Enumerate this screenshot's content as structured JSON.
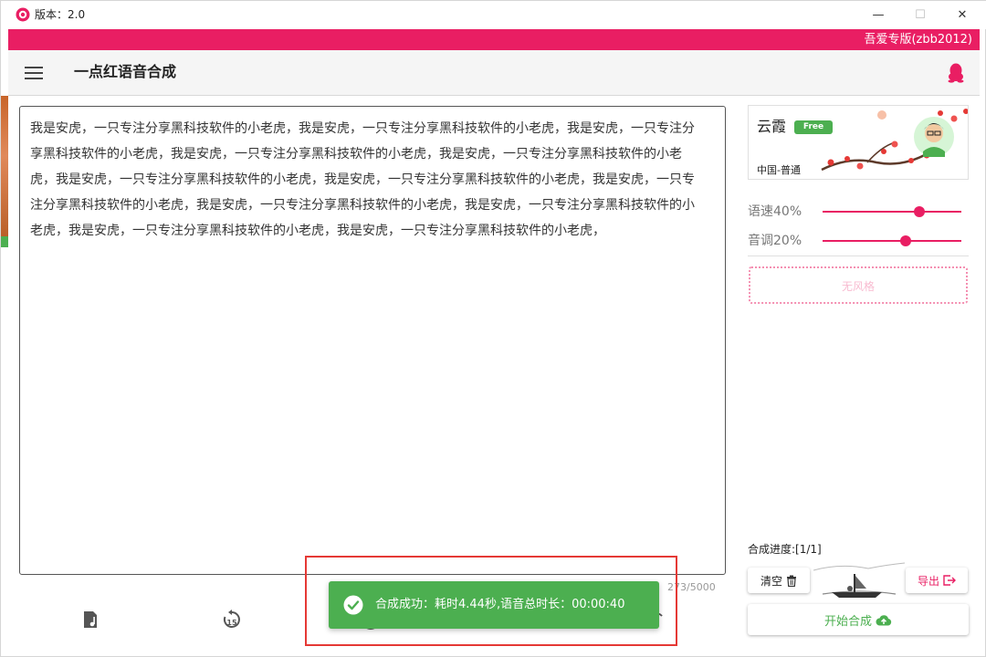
{
  "window": {
    "title": "版本：2.0",
    "controls": {
      "minimize": "—",
      "maximize": "☐",
      "close": "✕"
    }
  },
  "banner": {
    "text": "吾爱专版(zbb2012)"
  },
  "appbar": {
    "title": "一点红语音合成"
  },
  "editor": {
    "text": "我是安虎，一只专注分享黑科技软件的小老虎，我是安虎，一只专注分享黑科技软件的小老虎，我是安虎，一只专注分享黑科技软件的小老虎，我是安虎，一只专注分享黑科技软件的小老虎，我是安虎，一只专注分享黑科技软件的小老虎，我是安虎，一只专注分享黑科技软件的小老虎，我是安虎，一只专注分享黑科技软件的小老虎，我是安虎，一只专注分享黑科技软件的小老虎，我是安虎，一只专注分享黑科技软件的小老虎，我是安虎，一只专注分享黑科技软件的小老虎，我是安虎，一只专注分享黑科技软件的小老虎，我是安虎，一只专注分享黑科技软件的小老虎，",
    "char_count": "273/5000"
  },
  "toast": {
    "text": "合成成功：耗时4.44秒,语音总时长：00:00:40"
  },
  "voice": {
    "name": "云霞",
    "badge": "Free",
    "region": "中国-普通"
  },
  "sliders": [
    {
      "label": "语速40%",
      "value": 0.7
    },
    {
      "label": "音调20%",
      "value": 0.6
    }
  ],
  "style": {
    "placeholder": "无风格"
  },
  "progress": {
    "label": "合成进度:[1/1]"
  },
  "buttons": {
    "clear": "清空",
    "export": "导出",
    "start": "开始合成"
  },
  "colors": {
    "accent": "#e91e63",
    "success": "#4caf50"
  }
}
